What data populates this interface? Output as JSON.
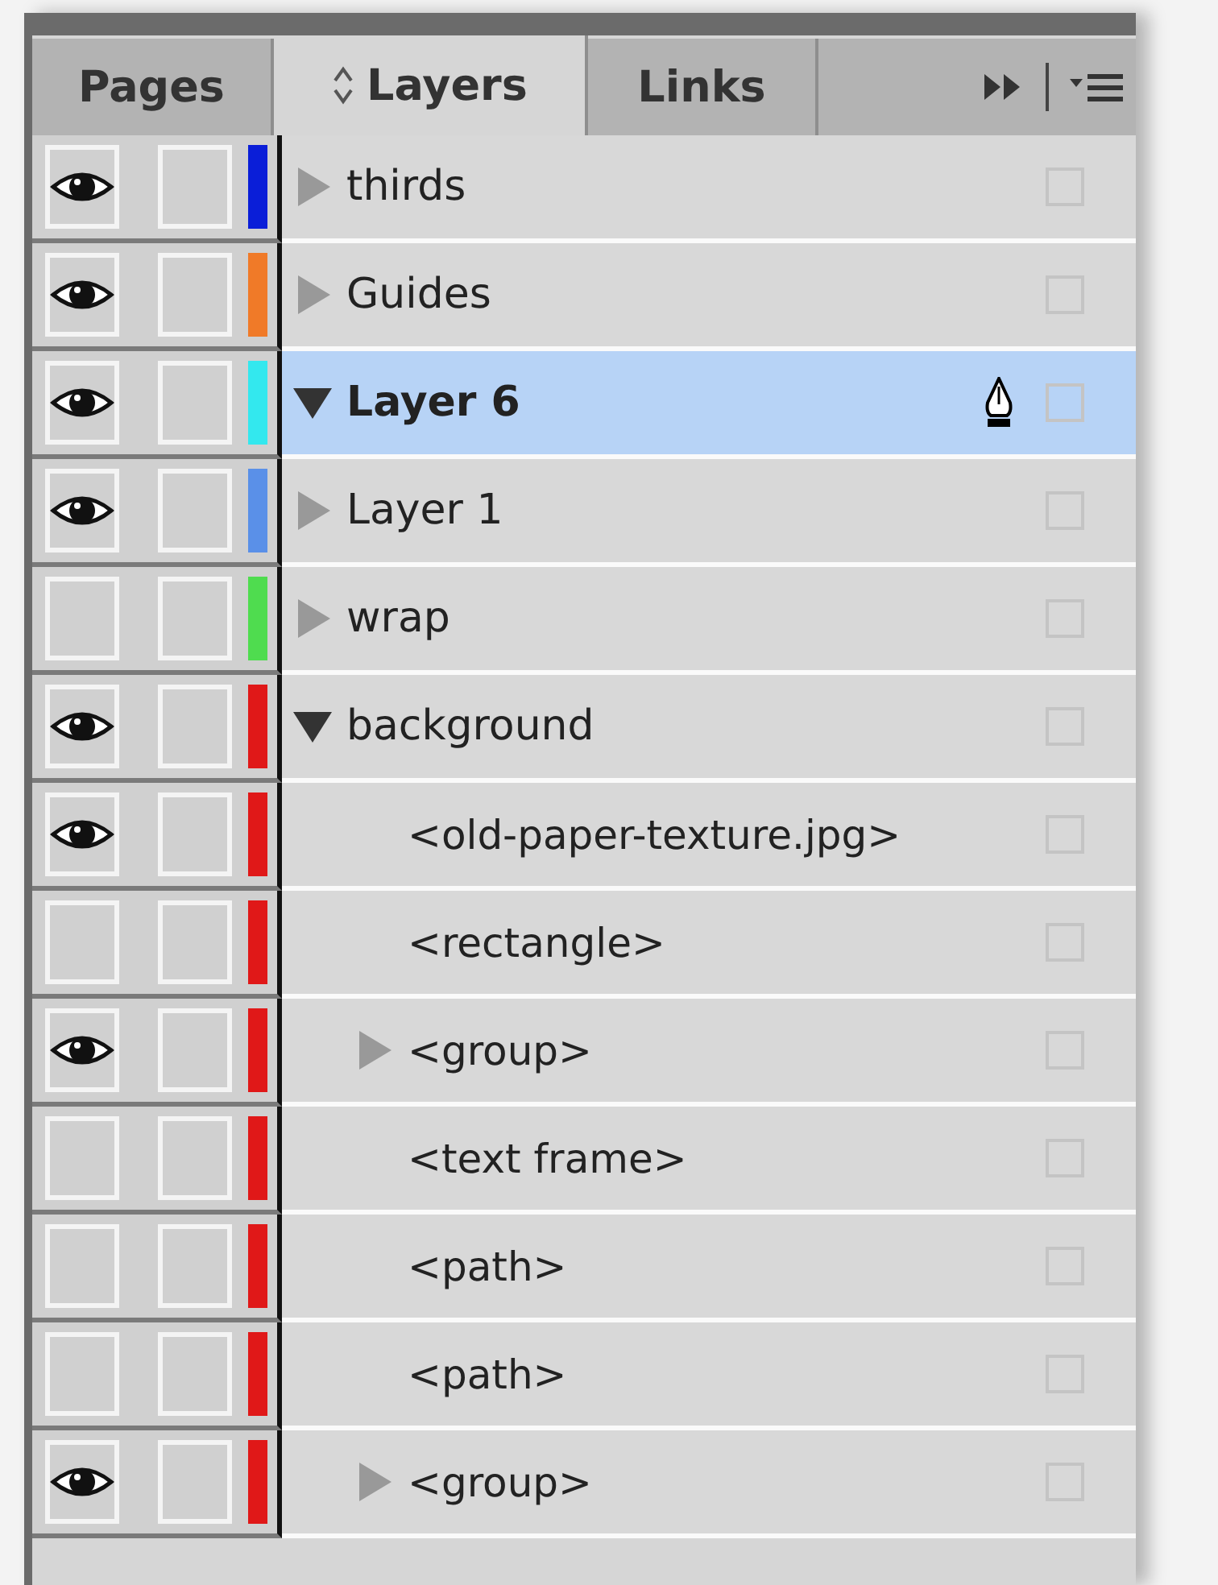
{
  "tabs": [
    {
      "label": "Pages",
      "selected": false
    },
    {
      "label": "Layers",
      "selected": true
    },
    {
      "label": "Links",
      "selected": false
    }
  ],
  "layers": [
    {
      "name": "thirds",
      "visible": true,
      "locked": false,
      "color": "#0a1ed8",
      "expanded": false,
      "selected": false,
      "current": false
    },
    {
      "name": "Guides",
      "visible": true,
      "locked": false,
      "color": "#f07a28",
      "expanded": false,
      "selected": false,
      "current": false
    },
    {
      "name": "Layer 6",
      "visible": true,
      "locked": false,
      "color": "#33e8ee",
      "expanded": true,
      "selected": true,
      "current": true
    },
    {
      "name": "Layer 1",
      "visible": true,
      "locked": false,
      "color": "#5a90e8",
      "expanded": false,
      "selected": false,
      "current": false
    },
    {
      "name": "wrap",
      "visible": false,
      "locked": false,
      "color": "#4fdc4f",
      "expanded": false,
      "selected": false,
      "current": false
    },
    {
      "name": "background",
      "visible": true,
      "locked": false,
      "color": "#e01818",
      "expanded": true,
      "selected": false,
      "current": false,
      "children": [
        {
          "name": "<old-paper-texture.jpg>",
          "visible": true,
          "locked": false
        },
        {
          "name": "<rectangle>",
          "visible": false,
          "locked": false
        },
        {
          "name": "<group>",
          "visible": true,
          "locked": false,
          "expanded": false
        },
        {
          "name": "<text frame>",
          "visible": false,
          "locked": false
        },
        {
          "name": "<path>",
          "visible": false,
          "locked": false
        },
        {
          "name": "<path>",
          "visible": false,
          "locked": false
        },
        {
          "name": "<group>",
          "visible": true,
          "locked": false,
          "expanded": false
        }
      ]
    }
  ]
}
